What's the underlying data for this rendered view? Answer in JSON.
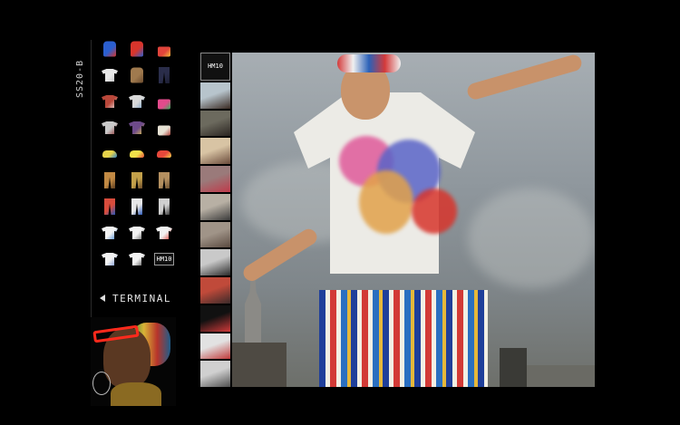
{
  "sidebar": {
    "season_label": "SS20-B",
    "terminal_label": "TERMINAL",
    "products": [
      {
        "kind": "jacket",
        "colors": [
          "#2b5fd0",
          "#d8352c"
        ]
      },
      {
        "kind": "jacket",
        "colors": [
          "#d8352c",
          "#2b5fd0"
        ]
      },
      {
        "kind": "bag",
        "colors": [
          "#e0443b",
          "#f3c13a"
        ]
      },
      {
        "kind": "tee",
        "colors": [
          "#e8e8e8",
          "#bdbdbd"
        ]
      },
      {
        "kind": "jacket",
        "colors": [
          "#a07a4e",
          "#6b4b2f"
        ]
      },
      {
        "kind": "pants",
        "colors": [
          "#2a2d4a",
          "#1a1c30"
        ]
      },
      {
        "kind": "tee",
        "colors": [
          "#b9473a",
          "#e5e5e5"
        ]
      },
      {
        "kind": "tee",
        "colors": [
          "#d9d9d9",
          "#7aa0c8"
        ]
      },
      {
        "kind": "bag",
        "colors": [
          "#e34b8c",
          "#35b35c"
        ]
      },
      {
        "kind": "tee",
        "colors": [
          "#c9c9c9",
          "#8c2f2f"
        ]
      },
      {
        "kind": "tee",
        "colors": [
          "#6d4a8a",
          "#e2c94b"
        ]
      },
      {
        "kind": "bag",
        "colors": [
          "#e7e2d4",
          "#b0413a"
        ]
      },
      {
        "kind": "shoe",
        "colors": [
          "#e5d34a",
          "#2a7fc8"
        ]
      },
      {
        "kind": "shoe",
        "colors": [
          "#f2e24a",
          "#e34b3b"
        ]
      },
      {
        "kind": "shoe",
        "colors": [
          "#e7483b",
          "#f2d34a"
        ]
      },
      {
        "kind": "pants",
        "colors": [
          "#c28a44",
          "#5d3d1f"
        ]
      },
      {
        "kind": "pants",
        "colors": [
          "#c2a04a",
          "#6a4a2a"
        ]
      },
      {
        "kind": "pants",
        "colors": [
          "#b49060",
          "#6b5030"
        ]
      },
      {
        "kind": "pants",
        "colors": [
          "#d84c3c",
          "#2a58b8"
        ]
      },
      {
        "kind": "pants",
        "colors": [
          "#e7e7e7",
          "#2a58b8"
        ]
      },
      {
        "kind": "pants",
        "colors": [
          "#d0d0d0",
          "#3a3a3a"
        ]
      },
      {
        "kind": "tee",
        "colors": [
          "#f2f2f2",
          "#3a7fd0"
        ]
      },
      {
        "kind": "tee",
        "colors": [
          "#f2f2f2",
          "#5a5a5a"
        ]
      },
      {
        "kind": "tee",
        "colors": [
          "#f2f2f2",
          "#d8352c"
        ]
      },
      {
        "kind": "tee",
        "colors": [
          "#f2f2f2",
          "#6a8ad0"
        ]
      },
      {
        "kind": "tee",
        "colors": [
          "#f2f2f2",
          "#444444"
        ]
      },
      {
        "kind": "tag",
        "text": "HM10"
      }
    ]
  },
  "strip": [
    {
      "text": "HM10",
      "colors": [
        "#111111",
        "#111111"
      ]
    },
    {
      "text": "",
      "colors": [
        "#b7c4cc",
        "#3a2a22"
      ]
    },
    {
      "text": "",
      "colors": [
        "#6c6a5e",
        "#2a2420"
      ]
    },
    {
      "text": "",
      "colors": [
        "#d8c4a4",
        "#6a4a3a"
      ]
    },
    {
      "text": "",
      "colors": [
        "#9a7a7a",
        "#c03a4a"
      ]
    },
    {
      "text": "",
      "colors": [
        "#b8b0a4",
        "#3a3a3a"
      ]
    },
    {
      "text": "",
      "colors": [
        "#a09488",
        "#5a4a40"
      ]
    },
    {
      "text": "",
      "colors": [
        "#c9c9c9",
        "#2a2a2a"
      ]
    },
    {
      "text": "",
      "colors": [
        "#c04a3a",
        "#3a2a2a"
      ]
    },
    {
      "text": "",
      "colors": [
        "#111111",
        "#d03a3a"
      ]
    },
    {
      "text": "",
      "colors": [
        "#e2e2e2",
        "#c03a3a"
      ]
    },
    {
      "text": "",
      "colors": [
        "#d0d0d0",
        "#505050"
      ]
    }
  ]
}
